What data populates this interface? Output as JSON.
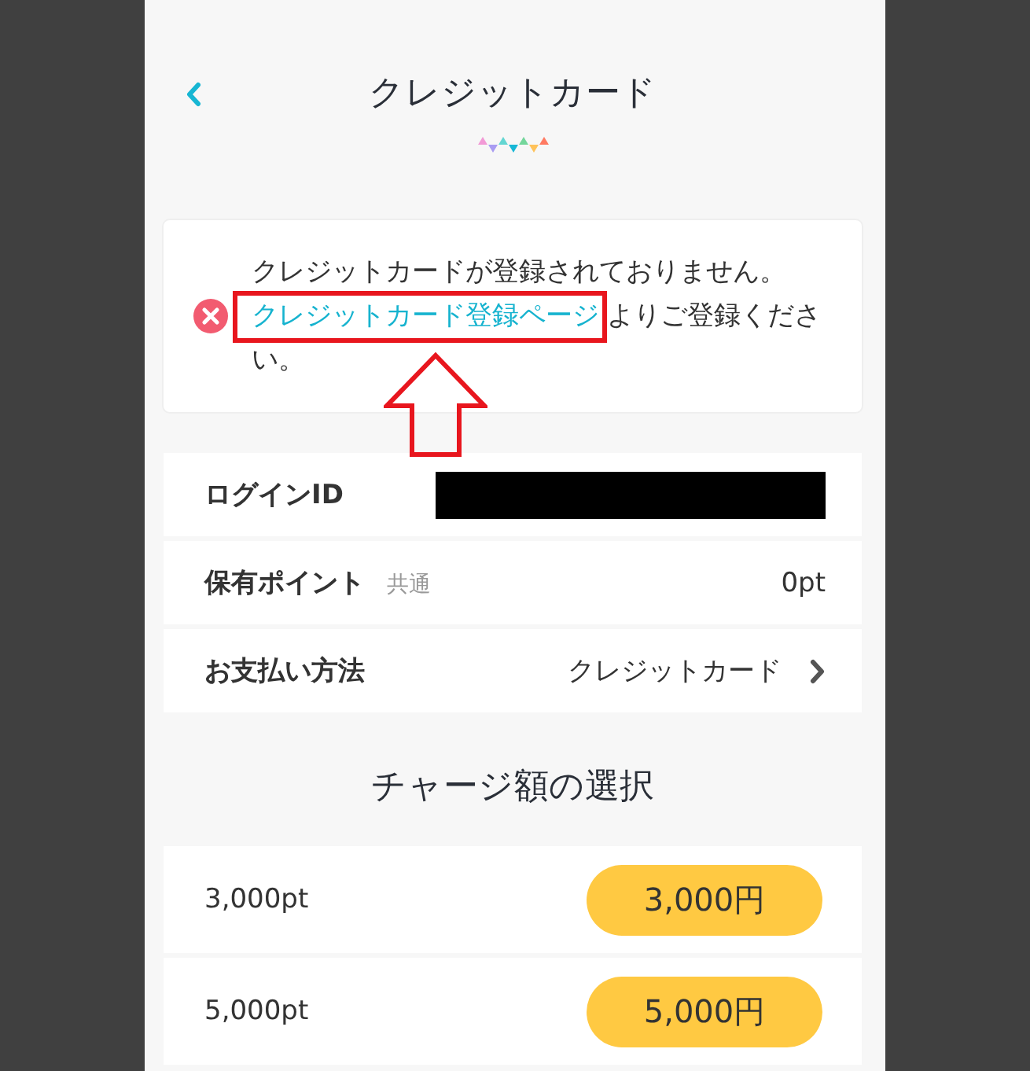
{
  "header": {
    "title": "クレジットカード"
  },
  "alert": {
    "message_before": "クレジットカードが登録されておりません。",
    "link": "クレジットカード登録ページ",
    "message_after": "よりご登録ください。"
  },
  "account_rows": [
    {
      "kind": "redacted",
      "label": "ログインID"
    },
    {
      "kind": "value",
      "label": "保有ポイント",
      "tag": "共通",
      "value": "0pt"
    },
    {
      "kind": "link",
      "label": "お支払い方法",
      "value": "クレジットカード"
    }
  ],
  "charge": {
    "title": "チャージ額の選択",
    "options": [
      {
        "label": "3,000pt",
        "button": "3,000円"
      },
      {
        "label": "5,000pt",
        "button": "5,000円"
      }
    ]
  }
}
